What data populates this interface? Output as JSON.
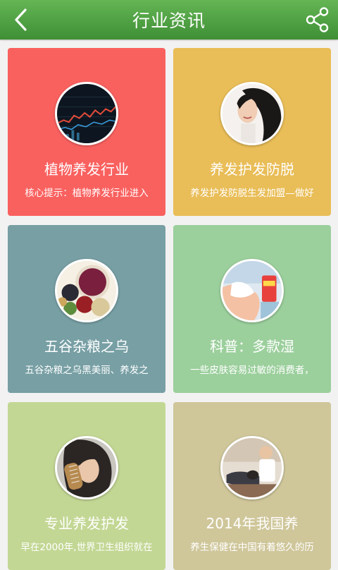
{
  "header": {
    "title": "行业资讯",
    "back_icon": "chevron-left-icon",
    "share_icon": "share-icon",
    "color": "#4fa244"
  },
  "cards": [
    {
      "title": "植物养发行业",
      "summary": "核心提示：植物养发行业进入",
      "color": "#f9615f",
      "image": "chart-screen-thumbnail"
    },
    {
      "title": "养发护发防脱",
      "summary": "养发护发防脱生发加盟—做好",
      "color": "#e9bd57",
      "image": "woman-long-hair-thumbnail"
    },
    {
      "title": "五谷杂粮之乌",
      "summary": "五谷杂粮之乌黑美丽、养发之",
      "color": "#779fa4",
      "image": "grains-bowl-thumbnail"
    },
    {
      "title": "科普：多款湿",
      "summary": "一些皮肤容易过敏的消费者，",
      "color": "#9bcf9c",
      "image": "wet-wipes-thumbnail"
    },
    {
      "title": "专业养发护发",
      "summary": "早在2000年,世界卫生组织就在",
      "color": "#c3d794",
      "image": "hair-comb-thumbnail"
    },
    {
      "title": "2014年我国养",
      "summary": "养生保健在中国有着悠久的历",
      "color": "#cfc69a",
      "image": "hair-salon-thumbnail"
    }
  ]
}
